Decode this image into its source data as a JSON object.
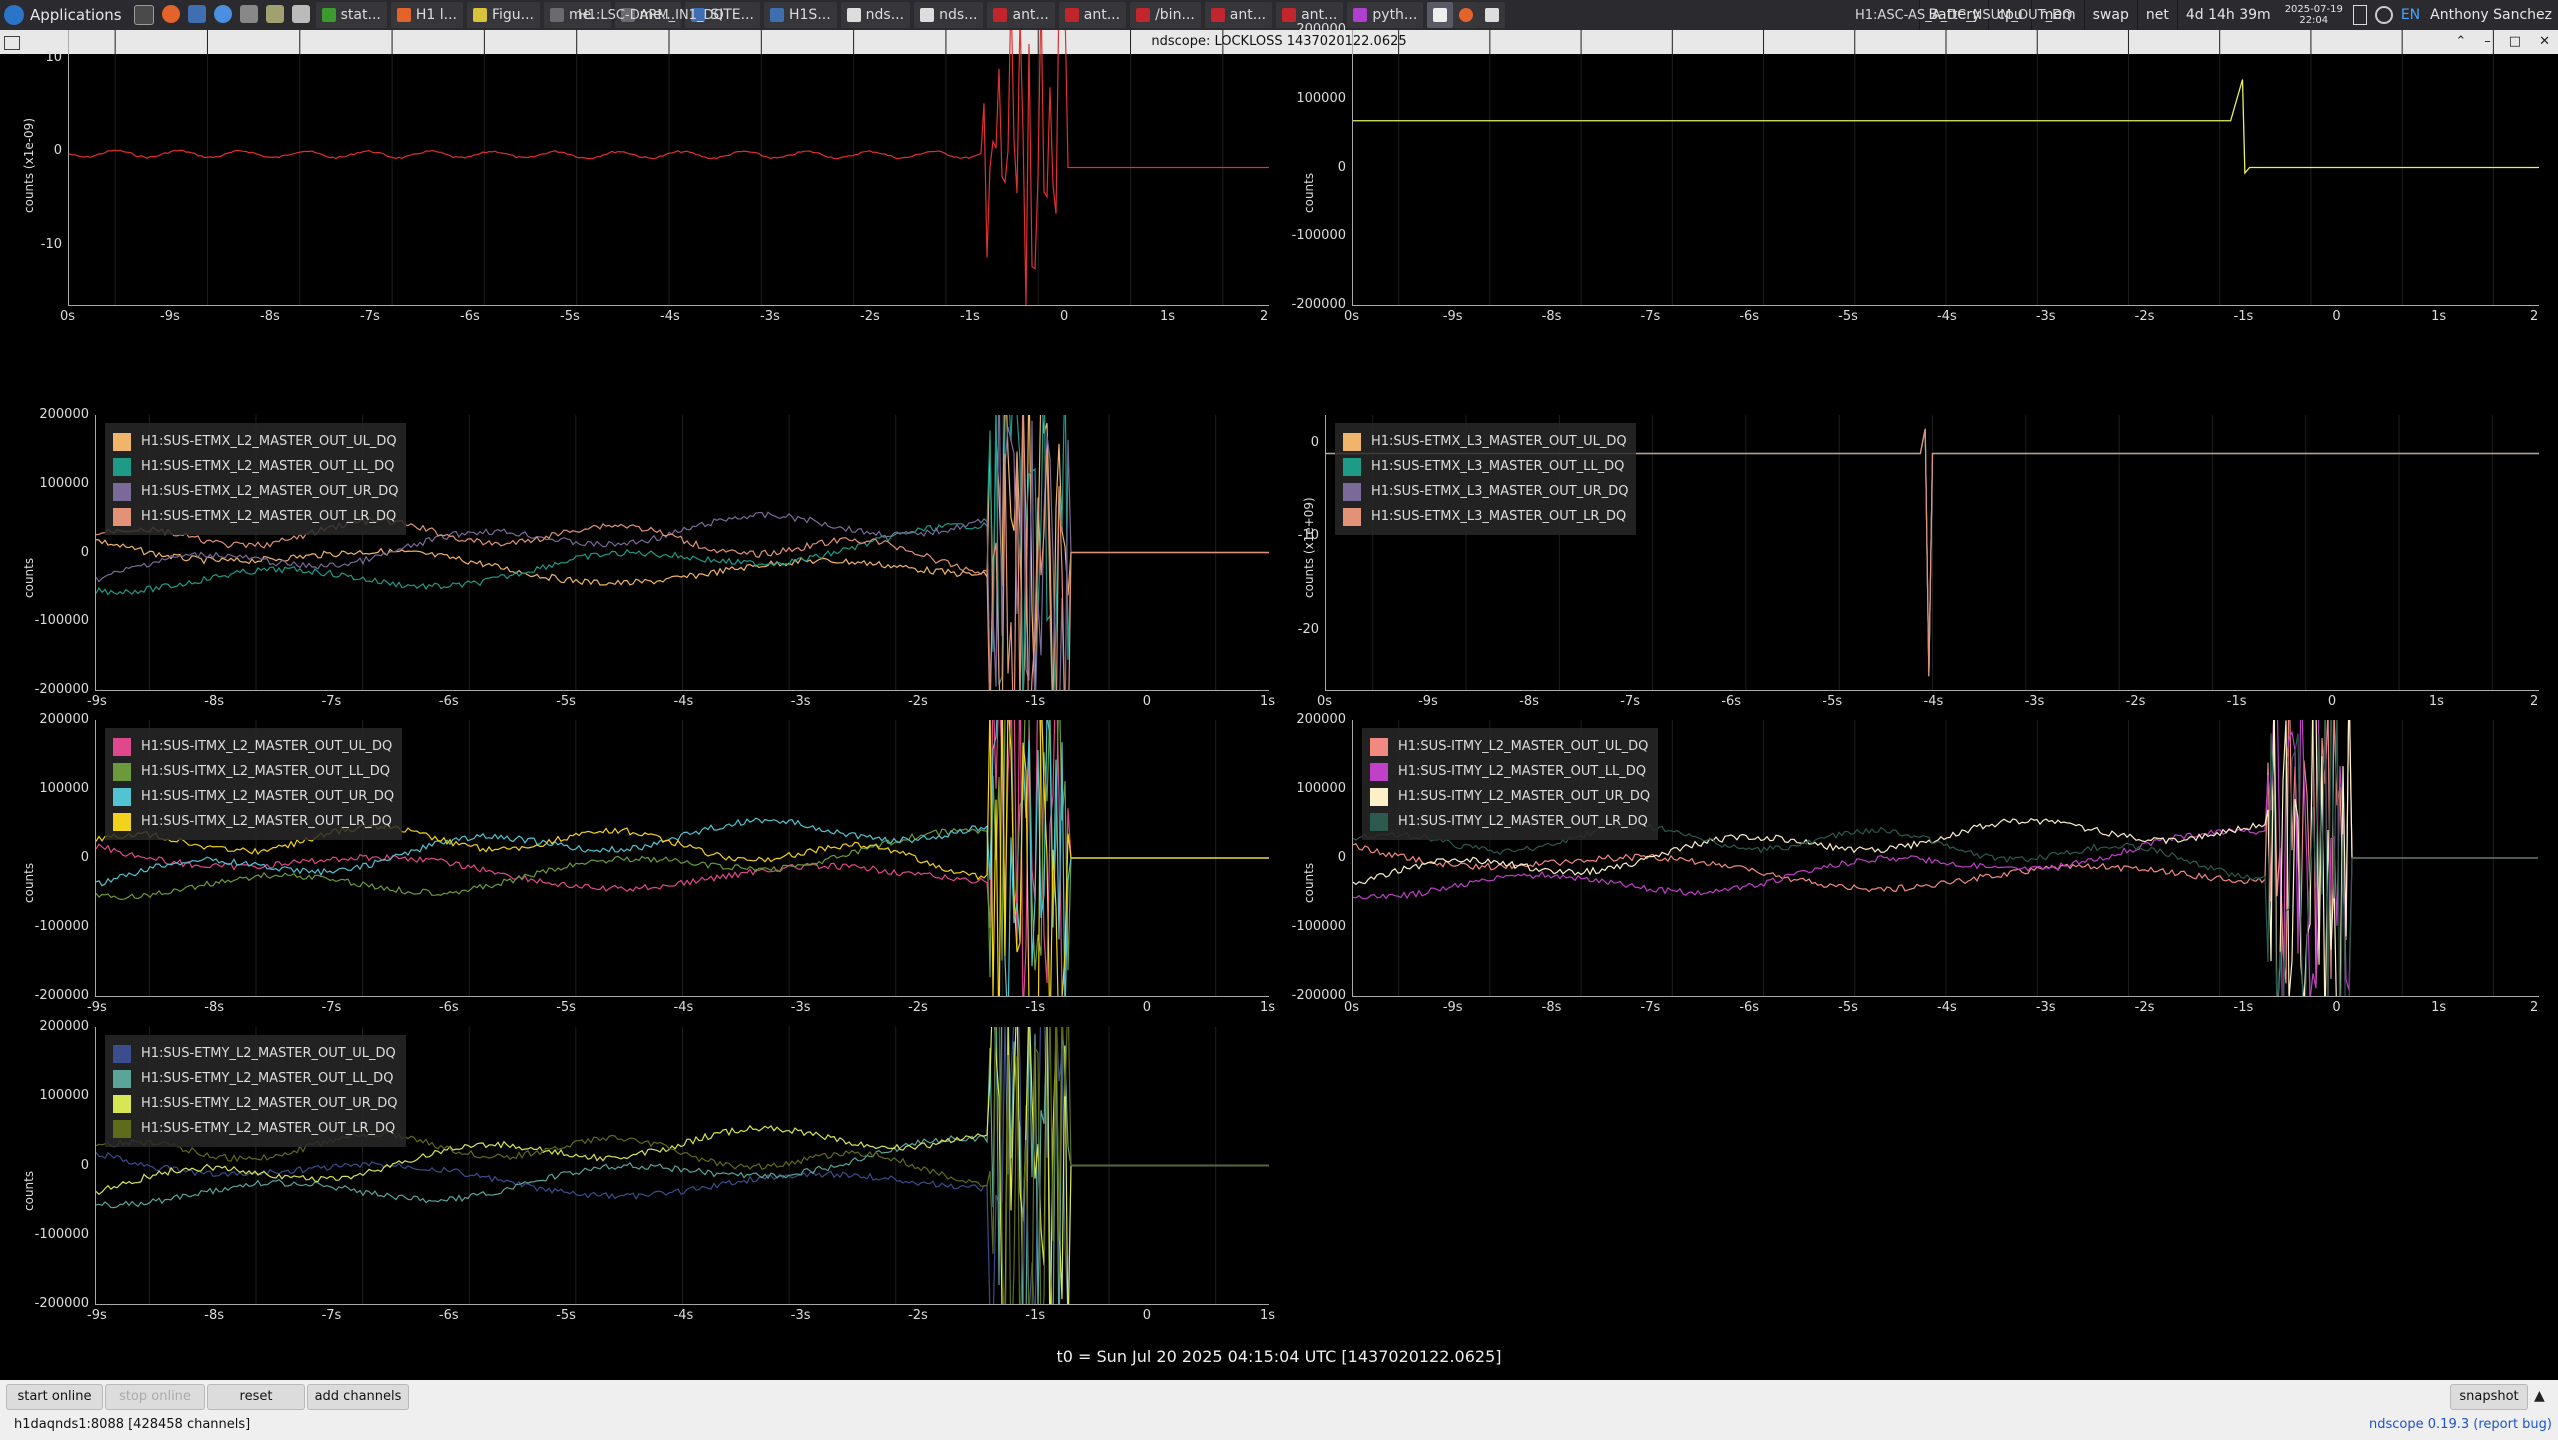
{
  "taskbar": {
    "applications_label": "Applications",
    "tasks": [
      {
        "label": "stat...",
        "color": "#3c9a2e"
      },
      {
        "label": "H1 l...",
        "color": "#e4632a"
      },
      {
        "label": "Figu...",
        "color": "#d9c33b"
      },
      {
        "label": "me...",
        "color": "#6a6a70"
      },
      {
        "label": "me...",
        "color": "#6a6a70"
      },
      {
        "label": "SITE...",
        "color": "#3f6fb0"
      },
      {
        "label": "H1S...",
        "color": "#3f6fb0"
      },
      {
        "label": "nds...",
        "color": "#dddddd"
      },
      {
        "label": "nds...",
        "color": "#dddddd"
      },
      {
        "label": "ant...",
        "color": "#c2262d"
      },
      {
        "label": "ant...",
        "color": "#c2262d"
      },
      {
        "label": "/bin...",
        "color": "#c2262d"
      },
      {
        "label": "ant...",
        "color": "#c2262d"
      },
      {
        "label": "ant...",
        "color": "#c2262d"
      },
      {
        "label": "pyth...",
        "color": "#b03fd0"
      }
    ],
    "monitors": [
      "Battery",
      "cpu",
      "mem",
      "swap",
      "net"
    ],
    "uptime": "4d 14h 39m",
    "date": "2025-07-19",
    "time": "22:04",
    "lang": "EN",
    "user": "Anthony Sanchez"
  },
  "window": {
    "title": "ndscope: LOCKLOSS 1437020122.0625"
  },
  "plots": {
    "p1": {
      "title": "H1:LSC-DARM_IN1_DQ",
      "ylabel": "counts (x1e-09)",
      "yticks": [
        "10",
        "0",
        "-10"
      ],
      "xticks": [
        "0s",
        "-9s",
        "-8s",
        "-7s",
        "-6s",
        "-5s",
        "-4s",
        "-3s",
        "-2s",
        "-1s",
        "0",
        "1s",
        "2"
      ]
    },
    "p2": {
      "title": "H1:ASC-AS_A_DC_NSUM_OUT_DQ",
      "ylabel": "counts",
      "yticks": [
        "200000",
        "100000",
        "0",
        "-100000",
        "-200000"
      ],
      "xticks": [
        "0s",
        "-9s",
        "-8s",
        "-7s",
        "-6s",
        "-5s",
        "-4s",
        "-3s",
        "-2s",
        "-1s",
        "0",
        "1s",
        "2"
      ]
    },
    "p3": {
      "ylabel": "counts",
      "yticks": [
        "200000",
        "100000",
        "0",
        "-100000",
        "-200000"
      ],
      "xticks": [
        "-9s",
        "-8s",
        "-7s",
        "-6s",
        "-5s",
        "-4s",
        "-3s",
        "-2s",
        "-1s",
        "0",
        "1s"
      ],
      "legend": [
        {
          "name": "H1:SUS-ETMX_L2_MASTER_OUT_UL_DQ",
          "color": "#f0b46a"
        },
        {
          "name": "H1:SUS-ETMX_L2_MASTER_OUT_LL_DQ",
          "color": "#1e9b86"
        },
        {
          "name": "H1:SUS-ETMX_L2_MASTER_OUT_UR_DQ",
          "color": "#7a6a9a"
        },
        {
          "name": "H1:SUS-ETMX_L2_MASTER_OUT_LR_DQ",
          "color": "#e29377"
        }
      ]
    },
    "p4": {
      "ylabel": "counts (x1e+09)",
      "yticks": [
        "0",
        "-10",
        "-20"
      ],
      "xticks": [
        "0s",
        "-9s",
        "-8s",
        "-7s",
        "-6s",
        "-5s",
        "-4s",
        "-3s",
        "-2s",
        "-1s",
        "0",
        "1s",
        "2"
      ],
      "legend": [
        {
          "name": "H1:SUS-ETMX_L3_MASTER_OUT_UL_DQ",
          "color": "#f0b46a"
        },
        {
          "name": "H1:SUS-ETMX_L3_MASTER_OUT_LL_DQ",
          "color": "#1e9b86"
        },
        {
          "name": "H1:SUS-ETMX_L3_MASTER_OUT_UR_DQ",
          "color": "#7a6a9a"
        },
        {
          "name": "H1:SUS-ETMX_L3_MASTER_OUT_LR_DQ",
          "color": "#e29377"
        }
      ]
    },
    "p5": {
      "ylabel": "counts",
      "yticks": [
        "200000",
        "100000",
        "0",
        "-100000",
        "-200000"
      ],
      "xticks": [
        "-9s",
        "-8s",
        "-7s",
        "-6s",
        "-5s",
        "-4s",
        "-3s",
        "-2s",
        "-1s",
        "0",
        "1s"
      ],
      "legend": [
        {
          "name": "H1:SUS-ITMX_L2_MASTER_OUT_UL_DQ",
          "color": "#e0488e"
        },
        {
          "name": "H1:SUS-ITMX_L2_MASTER_OUT_LL_DQ",
          "color": "#6b9a3a"
        },
        {
          "name": "H1:SUS-ITMX_L2_MASTER_OUT_UR_DQ",
          "color": "#52c3d0"
        },
        {
          "name": "H1:SUS-ITMX_L2_MASTER_OUT_LR_DQ",
          "color": "#f2d21b"
        }
      ]
    },
    "p6": {
      "ylabel": "counts",
      "yticks": [
        "200000",
        "100000",
        "0",
        "-100000",
        "-200000"
      ],
      "xticks": [
        "0s",
        "-9s",
        "-8s",
        "-7s",
        "-6s",
        "-5s",
        "-4s",
        "-3s",
        "-2s",
        "-1s",
        "0",
        "1s",
        "2"
      ],
      "legend": [
        {
          "name": "H1:SUS-ITMY_L2_MASTER_OUT_UL_DQ",
          "color": "#f08a80"
        },
        {
          "name": "H1:SUS-ITMY_L2_MASTER_OUT_LL_DQ",
          "color": "#c040c8"
        },
        {
          "name": "H1:SUS-ITMY_L2_MASTER_OUT_UR_DQ",
          "color": "#fbf0c8"
        },
        {
          "name": "H1:SUS-ITMY_L2_MASTER_OUT_LR_DQ",
          "color": "#2c5a4e"
        }
      ]
    },
    "p7": {
      "ylabel": "counts",
      "yticks": [
        "200000",
        "100000",
        "0",
        "-100000",
        "-200000"
      ],
      "xticks": [
        "-9s",
        "-8s",
        "-7s",
        "-6s",
        "-5s",
        "-4s",
        "-3s",
        "-2s",
        "-1s",
        "0",
        "1s"
      ],
      "legend": [
        {
          "name": "H1:SUS-ETMY_L2_MASTER_OUT_UL_DQ",
          "color": "#3a4d8c"
        },
        {
          "name": "H1:SUS-ETMY_L2_MASTER_OUT_LL_DQ",
          "color": "#5aa49a"
        },
        {
          "name": "H1:SUS-ETMY_L2_MASTER_OUT_UR_DQ",
          "color": "#d7e653"
        },
        {
          "name": "H1:SUS-ETMY_L2_MASTER_OUT_LR_DQ",
          "color": "#5e6b1a"
        }
      ]
    }
  },
  "t0_label": "t0 = Sun Jul 20 2025 04:15:04 UTC [1437020122.0625]",
  "controls": {
    "start_online": "start online",
    "stop_online": "stop online",
    "reset": "reset",
    "add_channels": "add channels",
    "snapshot": "snapshot"
  },
  "status": {
    "server": "h1daqnds1:8088  [428458 channels]",
    "app_name": "ndscope",
    "version": "0.19.3",
    "report_bug": "(report bug)"
  }
}
